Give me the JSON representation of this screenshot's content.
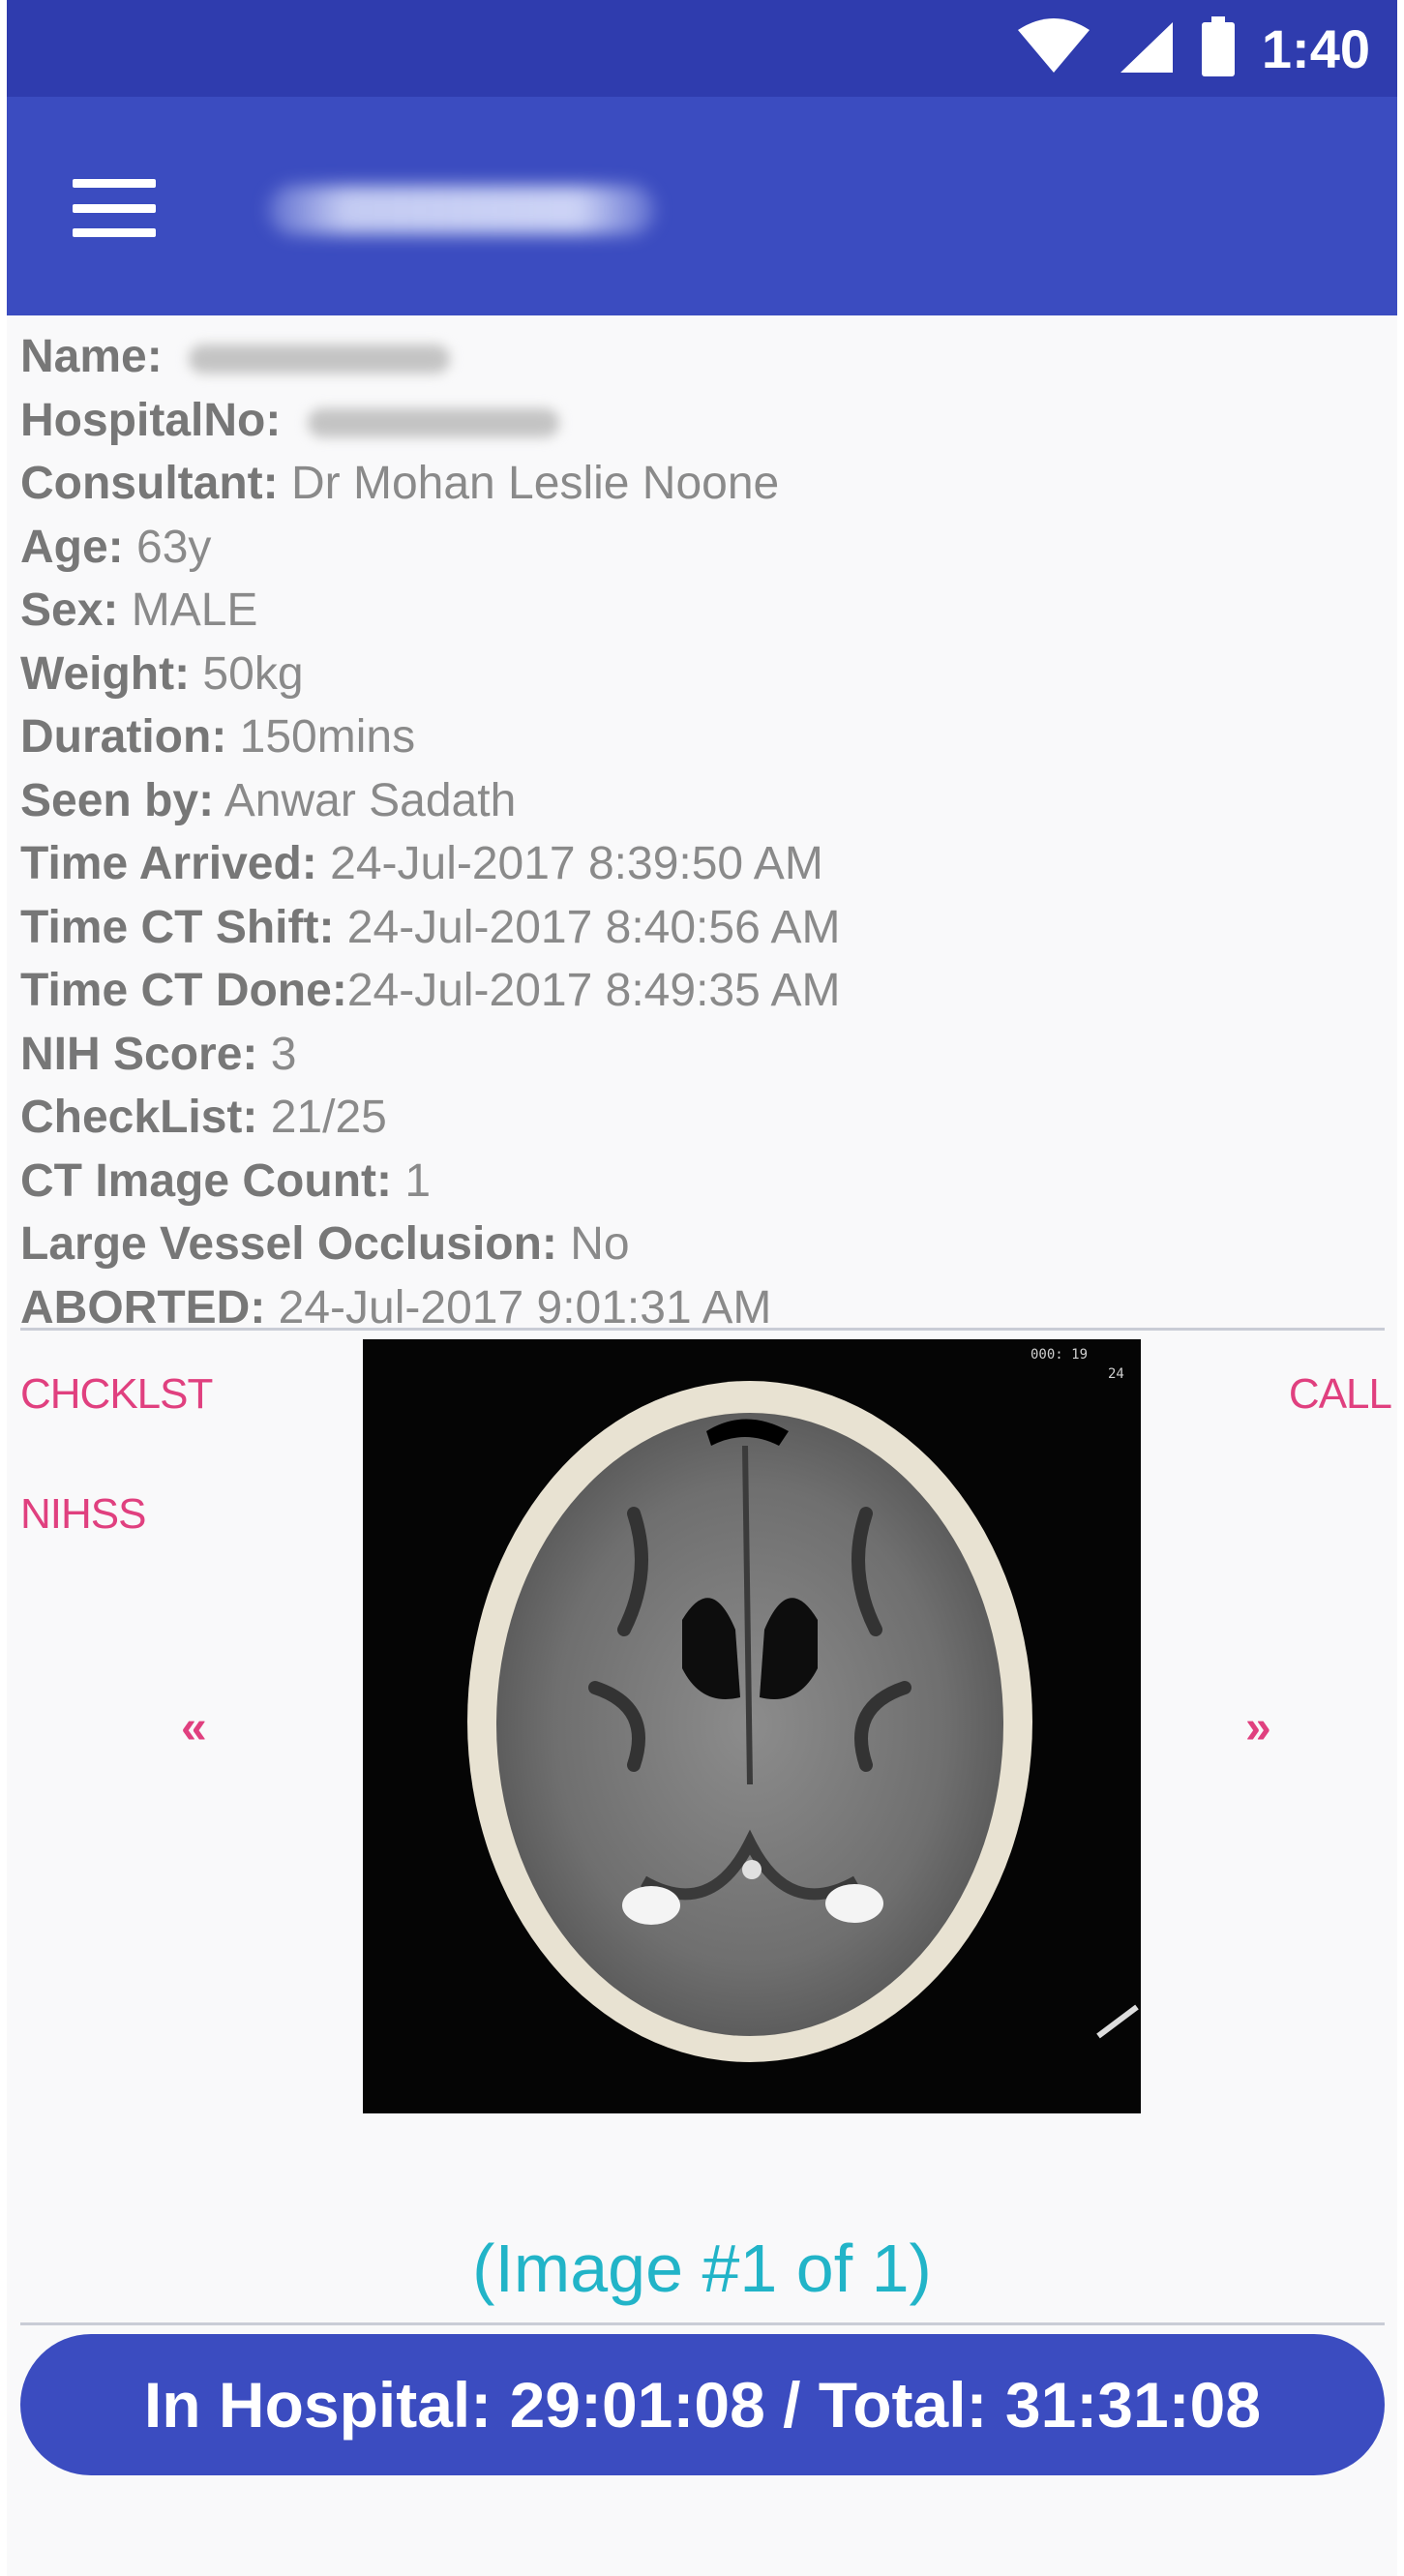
{
  "status_bar": {
    "time": "1:40",
    "icons": [
      "wifi-icon",
      "cell-signal-icon",
      "battery-icon"
    ],
    "background": "#2f3cae"
  },
  "app_bar": {
    "menu_icon": "hamburger-menu-icon",
    "background": "#3b4cc0"
  },
  "patient": {
    "name_label": "Name:",
    "hospital_no_label": "HospitalNo:",
    "consultant_label": "Consultant:",
    "consultant": "Dr Mohan Leslie Noone",
    "age_label": "Age:",
    "age": "63y",
    "sex_label": "Sex:",
    "sex": "MALE",
    "weight_label": "Weight:",
    "weight": "50kg",
    "duration_label": "Duration:",
    "duration": "150mins",
    "seen_by_label": "Seen by:",
    "seen_by": "Anwar Sadath",
    "time_arrived_label": "Time Arrived:",
    "time_arrived": "24-Jul-2017 8:39:50 AM",
    "time_ct_shift_label": "Time CT Shift:",
    "time_ct_shift": "24-Jul-2017 8:40:56 AM",
    "time_ct_done_label": "Time CT Done:",
    "time_ct_done": "24-Jul-2017 8:49:35 AM",
    "nih_score_label": "NIH Score:",
    "nih_score": "3",
    "checklist_label": "CheckList:",
    "checklist": "21/25",
    "ct_image_count_label": "CT Image Count:",
    "ct_image_count": "1",
    "lvo_label": "Large Vessel Occlusion:",
    "lvo": "No",
    "aborted_label": "ABORTED:",
    "aborted": "24-Jul-2017 9:01:31 AM"
  },
  "actions": {
    "checklist": "CHCKLST",
    "nihss": "NIHSS",
    "call": "CALL",
    "prev": "«",
    "next": "»"
  },
  "image_viewer": {
    "counter": "(Image #1 of 1)"
  },
  "timer": {
    "text": "In Hospital: 29:01:08 / Total: 31:31:08"
  },
  "colors": {
    "primary": "#3b4cc0",
    "accent_link": "#e0407f",
    "counter_text": "#22b4c8"
  }
}
